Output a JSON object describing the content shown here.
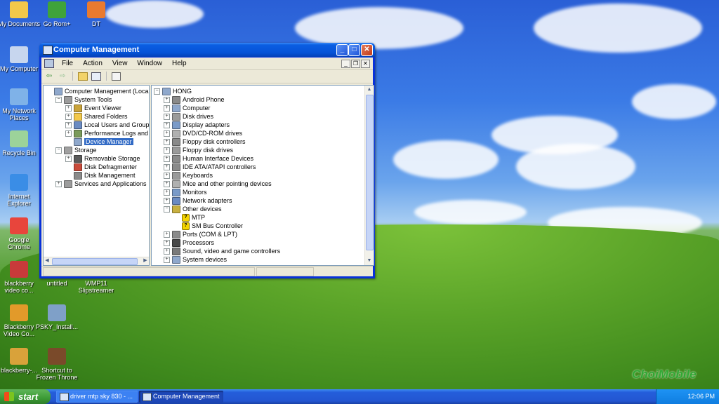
{
  "desktop_icons": [
    {
      "label": "My Documents",
      "icon": "folder-icon",
      "color": "#f2c84a"
    },
    {
      "label": "Go Rom+",
      "icon": "app-icon",
      "color": "#3fa33a"
    },
    {
      "label": "DT",
      "icon": "document-icon",
      "color": "#e97a2f"
    },
    {
      "label": "My Computer",
      "icon": "computer-icon",
      "color": "#c7d6ee"
    },
    {
      "label": "My Network Places",
      "icon": "network-icon",
      "color": "#7fb2e8"
    },
    {
      "label": "Recycle Bin",
      "icon": "recycle-bin-icon",
      "color": "#9cd39a"
    },
    {
      "label": "Internet Explorer",
      "icon": "internet-explorer-icon",
      "color": "#3a8de6"
    },
    {
      "label": "Google Chrome",
      "icon": "chrome-icon",
      "color": "#e8453c"
    },
    {
      "label": "blackberry video co...",
      "icon": "app-icon",
      "color": "#c83a3a"
    },
    {
      "label": "untitled",
      "icon": "document-icon",
      "color": "#6b8fb8"
    },
    {
      "label": "WMP11 Slipstreamer",
      "icon": "app-icon",
      "color": "#5a8f3c"
    },
    {
      "label": "Blackberry Video Co...",
      "icon": "app-icon",
      "color": "#e29a2a"
    },
    {
      "label": "PSKY_Install...",
      "icon": "installer-icon",
      "color": "#7fa0c8"
    },
    {
      "label": "blackberry-...",
      "icon": "package-icon",
      "color": "#d9a23a"
    },
    {
      "label": "Shortcut to Frozen Throne",
      "icon": "game-icon",
      "color": "#7a4a2a"
    }
  ],
  "window": {
    "title": "Computer Management",
    "menu": [
      "File",
      "Action",
      "View",
      "Window",
      "Help"
    ]
  },
  "left_tree": [
    {
      "label": "Computer Management (Local)",
      "level": 0,
      "exp": "",
      "icon": "computer-icon",
      "color": "#8fa8cc"
    },
    {
      "label": "System Tools",
      "level": 1,
      "exp": "-",
      "icon": "tools-icon",
      "color": "#9c9c9c"
    },
    {
      "label": "Event Viewer",
      "level": 2,
      "exp": "+",
      "icon": "event-viewer-icon",
      "color": "#c9a33a"
    },
    {
      "label": "Shared Folders",
      "level": 2,
      "exp": "+",
      "icon": "shared-folder-icon",
      "color": "#f2c84a"
    },
    {
      "label": "Local Users and Groups",
      "level": 2,
      "exp": "+",
      "icon": "users-icon",
      "color": "#6a8bc2"
    },
    {
      "label": "Performance Logs and Alerts",
      "level": 2,
      "exp": "+",
      "icon": "performance-icon",
      "color": "#7a9a5a"
    },
    {
      "label": "Device Manager",
      "level": 2,
      "exp": "",
      "icon": "device-manager-icon",
      "color": "#8fa8cc",
      "selected": true
    },
    {
      "label": "Storage",
      "level": 1,
      "exp": "-",
      "icon": "storage-icon",
      "color": "#a0a0a0"
    },
    {
      "label": "Removable Storage",
      "level": 2,
      "exp": "+",
      "icon": "removable-storage-icon",
      "color": "#5a5a5a"
    },
    {
      "label": "Disk Defragmenter",
      "level": 2,
      "exp": "",
      "icon": "defrag-icon",
      "color": "#c84a3a"
    },
    {
      "label": "Disk Management",
      "level": 2,
      "exp": "",
      "icon": "disk-management-icon",
      "color": "#8a8a8a"
    },
    {
      "label": "Services and Applications",
      "level": 1,
      "exp": "+",
      "icon": "services-icon",
      "color": "#9c9c9c"
    }
  ],
  "right_tree": [
    {
      "label": "HONG",
      "level": 0,
      "exp": "-",
      "icon": "computer-icon",
      "color": "#8fa8cc"
    },
    {
      "label": "Android Phone",
      "level": 1,
      "exp": "+",
      "icon": "phone-icon",
      "color": "#8a8a8a"
    },
    {
      "label": "Computer",
      "level": 1,
      "exp": "+",
      "icon": "computer-icon",
      "color": "#8fa8cc"
    },
    {
      "label": "Disk drives",
      "level": 1,
      "exp": "+",
      "icon": "disk-icon",
      "color": "#9a9a9a"
    },
    {
      "label": "Display adapters",
      "level": 1,
      "exp": "+",
      "icon": "display-icon",
      "color": "#7a9ac8"
    },
    {
      "label": "DVD/CD-ROM drives",
      "level": 1,
      "exp": "+",
      "icon": "cdrom-icon",
      "color": "#b0b0b0"
    },
    {
      "label": "Floppy disk controllers",
      "level": 1,
      "exp": "+",
      "icon": "floppy-controller-icon",
      "color": "#8a8a8a"
    },
    {
      "label": "Floppy disk drives",
      "level": 1,
      "exp": "+",
      "icon": "floppy-icon",
      "color": "#9a9a9a"
    },
    {
      "label": "Human Interface Devices",
      "level": 1,
      "exp": "+",
      "icon": "hid-icon",
      "color": "#8a8a8a"
    },
    {
      "label": "IDE ATA/ATAPI controllers",
      "level": 1,
      "exp": "+",
      "icon": "ide-icon",
      "color": "#8a8a8a"
    },
    {
      "label": "Keyboards",
      "level": 1,
      "exp": "+",
      "icon": "keyboard-icon",
      "color": "#9a9a9a"
    },
    {
      "label": "Mice and other pointing devices",
      "level": 1,
      "exp": "+",
      "icon": "mouse-icon",
      "color": "#b0b0b0"
    },
    {
      "label": "Monitors",
      "level": 1,
      "exp": "+",
      "icon": "monitor-icon",
      "color": "#7a9ac8"
    },
    {
      "label": "Network adapters",
      "level": 1,
      "exp": "+",
      "icon": "network-adapter-icon",
      "color": "#6a8ac2"
    },
    {
      "label": "Other devices",
      "level": 1,
      "exp": "-",
      "icon": "unknown-device-icon",
      "color": "#c8b040"
    },
    {
      "label": "MTP",
      "level": 2,
      "exp": "",
      "icon": "warning-device-icon",
      "color": "#f4d400",
      "warn": true
    },
    {
      "label": "SM Bus Controller",
      "level": 2,
      "exp": "",
      "icon": "warning-device-icon",
      "color": "#f4d400",
      "warn": true
    },
    {
      "label": "Ports (COM & LPT)",
      "level": 1,
      "exp": "+",
      "icon": "port-icon",
      "color": "#8a8a8a"
    },
    {
      "label": "Processors",
      "level": 1,
      "exp": "+",
      "icon": "processor-icon",
      "color": "#4a4a4a"
    },
    {
      "label": "Sound, video and game controllers",
      "level": 1,
      "exp": "+",
      "icon": "sound-icon",
      "color": "#7a7a7a"
    },
    {
      "label": "System devices",
      "level": 1,
      "exp": "+",
      "icon": "system-devices-icon",
      "color": "#8fa8cc"
    }
  ],
  "taskbar": {
    "start_label": "start",
    "tasks": [
      {
        "label": "driver mtp sky 830 - ...",
        "active": false
      },
      {
        "label": "Computer Management",
        "active": true
      }
    ],
    "clock": "12:06 PM"
  },
  "watermark": "ChoiMobile"
}
